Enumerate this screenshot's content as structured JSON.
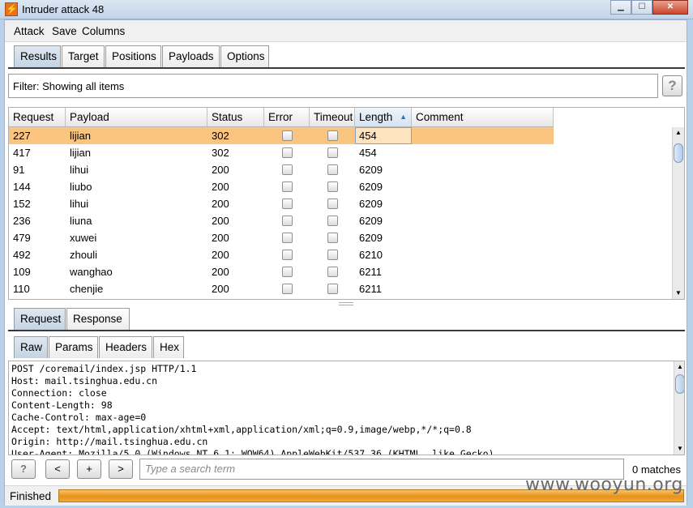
{
  "window": {
    "title": "Intruder attack 48",
    "icon": "lightning-bolt-icon",
    "controls": [
      "minimize-icon",
      "maximize-icon",
      "close-icon"
    ]
  },
  "menu": [
    "Attack",
    "Save",
    "Columns"
  ],
  "main_tabs": {
    "items": [
      "Results",
      "Target",
      "Positions",
      "Payloads",
      "Options"
    ],
    "active": "Results"
  },
  "filter": {
    "text": "Filter: Showing all items",
    "help_label": "?"
  },
  "table": {
    "columns": [
      "Request",
      "Payload",
      "Status",
      "Error",
      "Timeout",
      "Length",
      "Comment"
    ],
    "sorted_column": "Length",
    "sort_direction": "ascending",
    "selected_row": 0,
    "rows": [
      {
        "request": "227",
        "payload": "lijian",
        "status": "302",
        "error": false,
        "timeout": false,
        "length": "454",
        "comment": ""
      },
      {
        "request": "417",
        "payload": "lijian",
        "status": "302",
        "error": false,
        "timeout": false,
        "length": "454",
        "comment": ""
      },
      {
        "request": "91",
        "payload": "lihui",
        "status": "200",
        "error": false,
        "timeout": false,
        "length": "6209",
        "comment": ""
      },
      {
        "request": "144",
        "payload": "liubo",
        "status": "200",
        "error": false,
        "timeout": false,
        "length": "6209",
        "comment": ""
      },
      {
        "request": "152",
        "payload": "lihui",
        "status": "200",
        "error": false,
        "timeout": false,
        "length": "6209",
        "comment": ""
      },
      {
        "request": "236",
        "payload": "liuna",
        "status": "200",
        "error": false,
        "timeout": false,
        "length": "6209",
        "comment": ""
      },
      {
        "request": "479",
        "payload": "xuwei",
        "status": "200",
        "error": false,
        "timeout": false,
        "length": "6209",
        "comment": ""
      },
      {
        "request": "492",
        "payload": "zhouli",
        "status": "200",
        "error": false,
        "timeout": false,
        "length": "6210",
        "comment": ""
      },
      {
        "request": "109",
        "payload": "wanghao",
        "status": "200",
        "error": false,
        "timeout": false,
        "length": "6211",
        "comment": ""
      },
      {
        "request": "110",
        "payload": "chenjie",
        "status": "200",
        "error": false,
        "timeout": false,
        "length": "6211",
        "comment": ""
      }
    ]
  },
  "detail_tabs": {
    "items": [
      "Request",
      "Response"
    ],
    "active": "Request"
  },
  "view_tabs": {
    "items": [
      "Raw",
      "Params",
      "Headers",
      "Hex"
    ],
    "active": "Raw"
  },
  "request_raw": [
    "POST /coremail/index.jsp HTTP/1.1",
    "Host: mail.tsinghua.edu.cn",
    "Connection: close",
    "Content-Length: 98",
    "Cache-Control: max-age=0",
    "Accept: text/html,application/xhtml+xml,application/xml;q=0.9,image/webp,*/*;q=0.8",
    "Origin: http://mail.tsinghua.edu.cn",
    "User-Agent: Mozilla/5.0 (Windows NT 6.1; WOW64) AppleWebKit/537.36 (KHTML, like Gecko)"
  ],
  "search": {
    "buttons": [
      "?",
      "<",
      "+",
      ">"
    ],
    "placeholder": "Type a search term",
    "value": "",
    "matches": "0 matches"
  },
  "status": {
    "text": "Finished",
    "progress": 1.0
  },
  "watermark": "www.wooyun.org",
  "colors": {
    "selected_row": "#fbc47f",
    "progress": "#e7921a",
    "active_tab": "#c5d4e3"
  }
}
